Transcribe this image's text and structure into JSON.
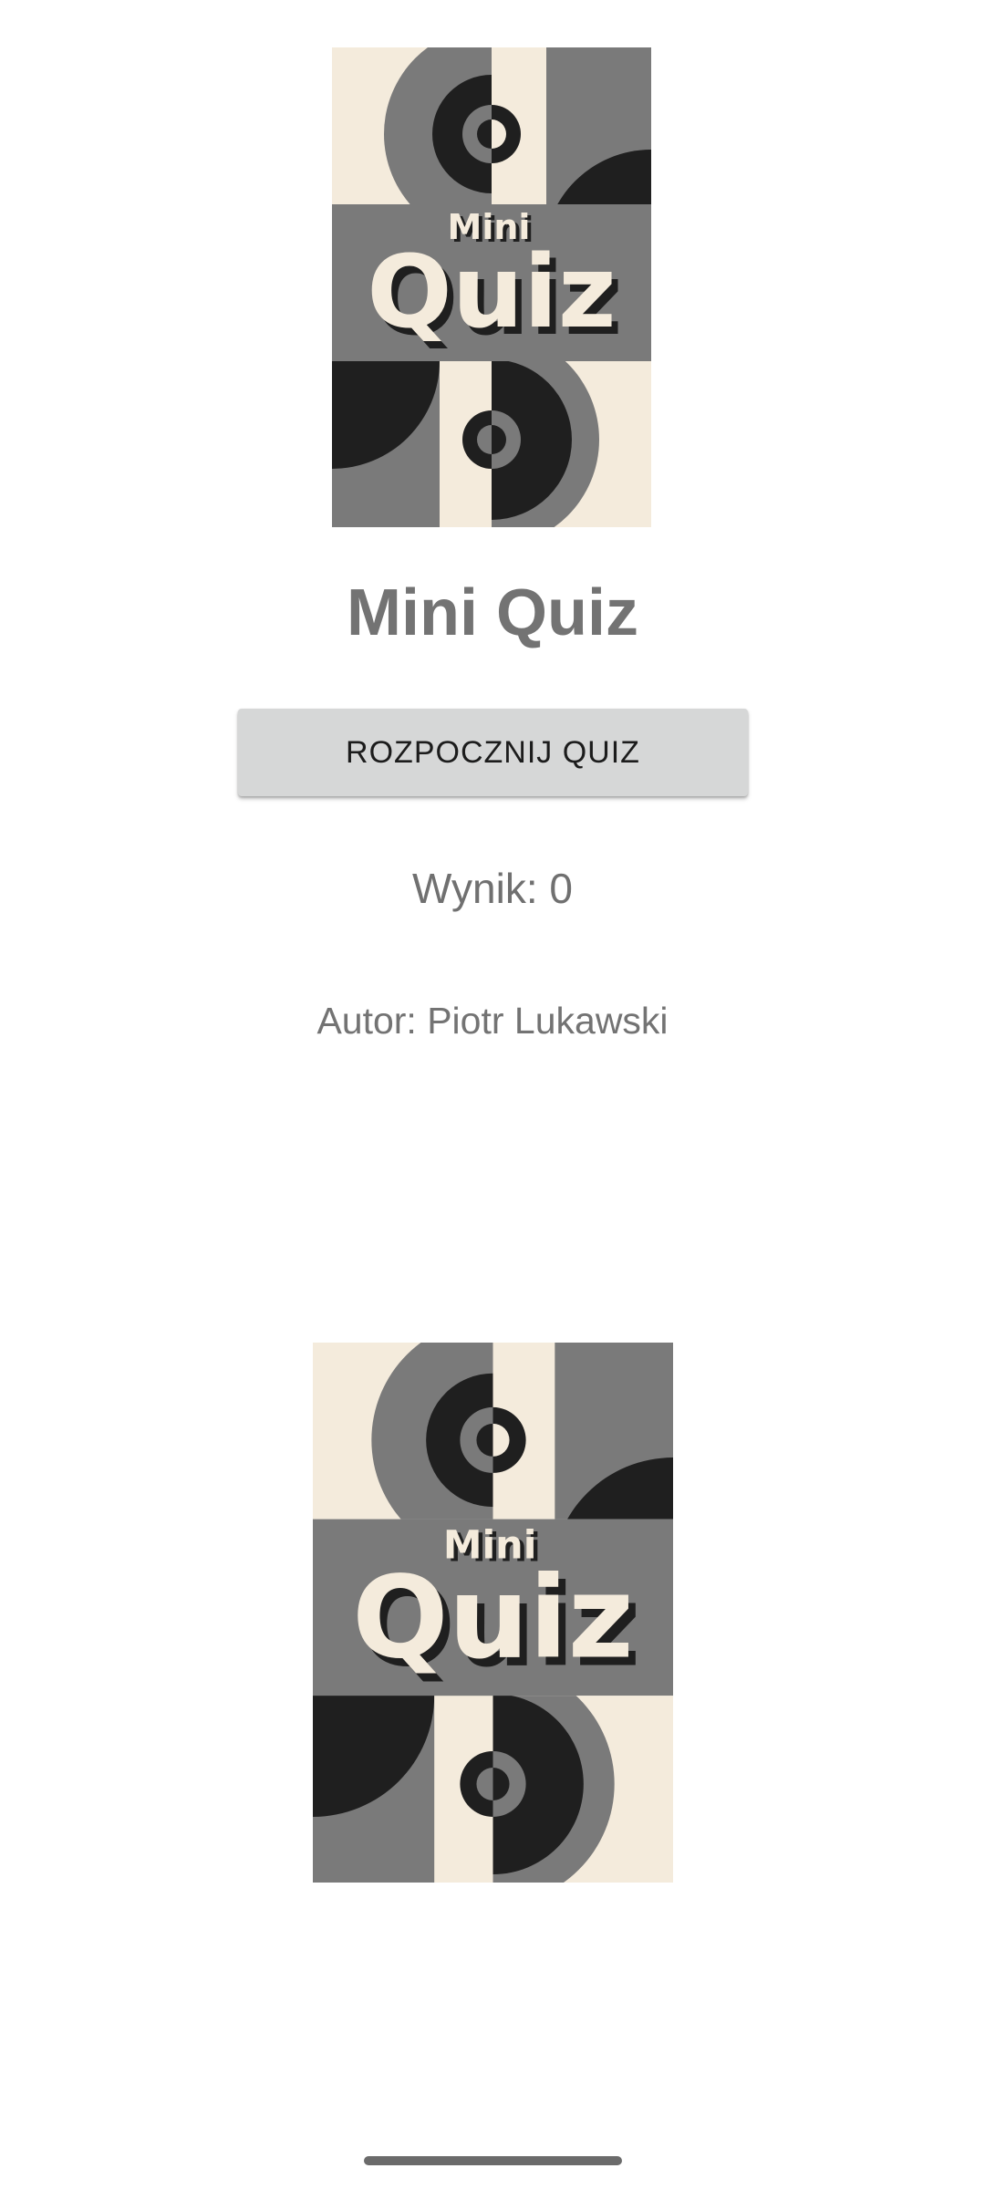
{
  "colors": {
    "cream": "#f4ebdc",
    "gray": "#7a7a7a",
    "dark": "#1f1f1f",
    "title_text": "#737373",
    "button_bg": "#d6d7d7",
    "button_text": "#1c1c1c"
  },
  "cover": {
    "word_small": "Mini",
    "word_large": "Quiz"
  },
  "app": {
    "title": "Mini Quiz",
    "start_button_label": "ROZPOCZNIJ QUIZ",
    "score_text": "Wynik: 0",
    "author_text": "Autor: Piotr Lukawski"
  }
}
